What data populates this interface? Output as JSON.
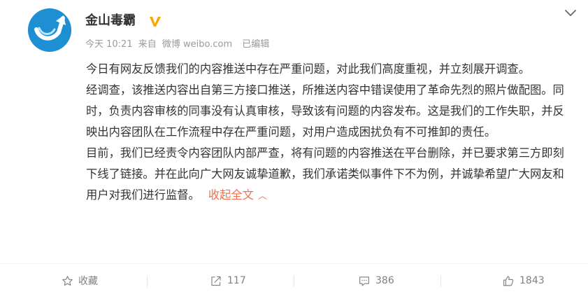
{
  "account": {
    "name": "金山毒霸",
    "avatar_icon": "kingsoft-logo-icon",
    "verified_icon": "verified-v-icon",
    "verified_color": "#ffa500"
  },
  "meta": {
    "time": "今天 10:21",
    "source_prefix": "来自",
    "source": "微博 weibo.com",
    "edited": "已编辑"
  },
  "post": {
    "paragraphs": [
      "今日有网友反馈我们的内容推送中存在严重问题，对此我们高度重视，并立刻展开调查。",
      "经调查，该推送内容出自第三方接口推送，所推送内容中错误使用了革命先烈的照片做配图。同时，负责内容审核的同事没有认真审核，导致该有问题的内容发布。这是我们的工作失职，并反映出内容团队在工作流程中存在严重问题，对用户造成困扰负有不可推卸的责任。",
      "目前，我们已经责令内容团队内部严查，将有问题的内容推送在平台删除，并已要求第三方即刻下线了链接。并在此向广大网友诚挚道歉，我们承诺类似事件下不为例，并诚挚希望广大网友和用户对我们进行监督。"
    ],
    "collapse_label": "收起全文",
    "collapse_icon": "chevron-up-icon",
    "link_color": "#eb7350"
  },
  "actions": {
    "favorite_label": "收藏",
    "repost_count": "117",
    "comment_count": "386",
    "like_count": "1843"
  }
}
